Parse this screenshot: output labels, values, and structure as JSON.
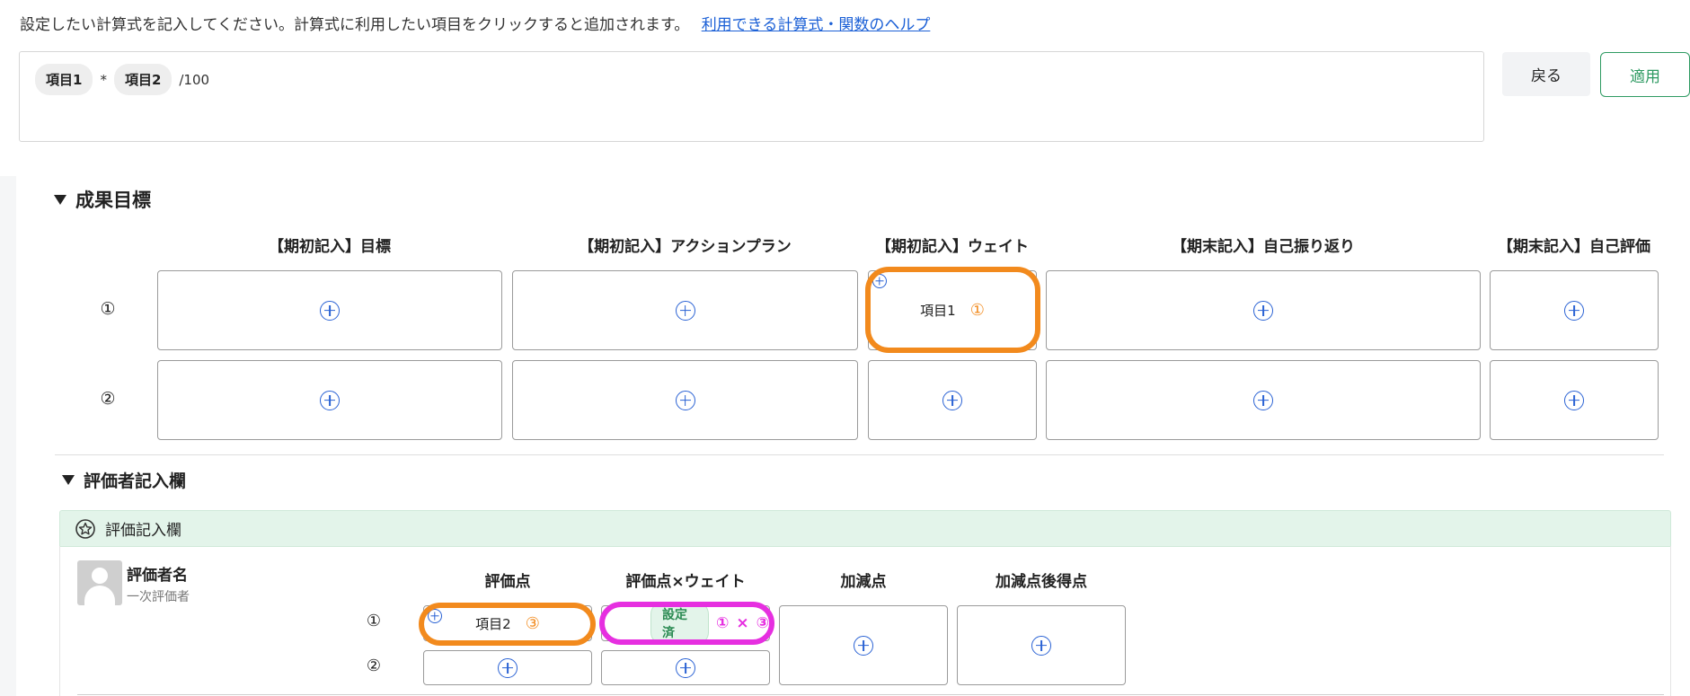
{
  "formula": {
    "instruction": "設定したい計算式を記入してください。計算式に利用したい項目をクリックすると追加されます。",
    "help_link": "利用できる計算式・関数のヘルプ",
    "chip1": "項目1",
    "op1": "*",
    "chip2": "項目2",
    "op2": "/100"
  },
  "buttons": {
    "back": "戻る",
    "apply": "適用"
  },
  "section1": {
    "title": "成果目標",
    "columns": [
      "【期初記入】目標",
      "【期初記入】アクションプラン",
      "【期初記入】ウェイト",
      "【期末記入】自己振り返り",
      "【期末記入】自己評価"
    ],
    "rows": [
      "①",
      "②"
    ],
    "weight_item_label": "項目1",
    "weight_item_num": "①"
  },
  "section2": {
    "title": "評価者記入欄",
    "panel_title": "評価記入欄",
    "evaluator_name": "評価者名",
    "evaluator_role": "一次評価者",
    "columns": [
      "評価点",
      "評価点×ウェイト",
      "加減点",
      "加減点後得点"
    ],
    "rows": [
      "①",
      "②"
    ],
    "score_item_label": "項目2",
    "score_item_num": "③",
    "weighted_badge": "設定済",
    "weighted_formula_a": "①",
    "weighted_formula_op": "×",
    "weighted_formula_b": "③"
  },
  "colors": {
    "accent_blue": "#2a62d4",
    "highlight_orange": "#f28a1d",
    "highlight_pink": "#e62fe0",
    "apply_green": "#2e9a62"
  }
}
